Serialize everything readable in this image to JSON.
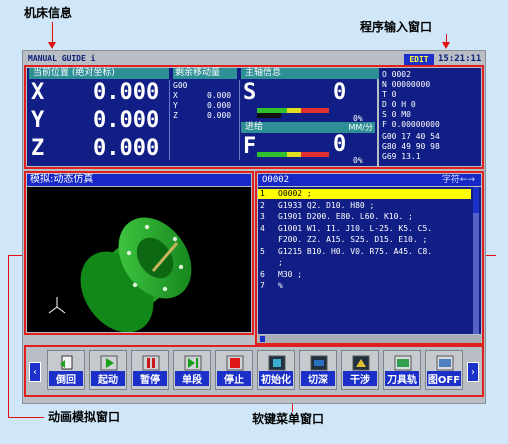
{
  "annotations": {
    "machine_info": "机床信息",
    "program_input": "程序输入窗口",
    "animation_window": "动画模拟窗口",
    "softkey_window": "软键菜单窗口"
  },
  "status_bar": {
    "title": "MANUAL GUIDE i",
    "mode": "EDIT",
    "time": "15:21:11"
  },
  "position": {
    "header": "当前位置 (绝对坐标)",
    "axes": [
      {
        "axis": "X",
        "value": "0.000"
      },
      {
        "axis": "Y",
        "value": "0.000"
      },
      {
        "axis": "Z",
        "value": "0.000"
      }
    ]
  },
  "remaining": {
    "header": "剩余移动量",
    "code": "G00",
    "rows": [
      {
        "axis": "X",
        "value": "0.000"
      },
      {
        "axis": "Y",
        "value": "0.000"
      },
      {
        "axis": "Z",
        "value": "0.000"
      }
    ]
  },
  "spindle": {
    "header": "主轴信息",
    "letter": "S",
    "value": "0",
    "load_pct": "0%",
    "load_fraction": 0
  },
  "feed": {
    "header": "进给",
    "unit": "MM/分",
    "letter": "F",
    "value": "0",
    "load_pct": "0%",
    "load_fraction": 0
  },
  "modal": {
    "lines": [
      "O  0002",
      "N  00000000",
      "T  0",
      "D  0      H  0",
      "S       0  M0",
      "F  0.00000000",
      "G00   17   40   54",
      "G80   49   90   98",
      "G69   13.1"
    ]
  },
  "simulation": {
    "title": "模拟:动态仿真"
  },
  "program": {
    "name": "O0002",
    "mode_label": "字符←→",
    "lines": [
      {
        "num": "1",
        "text": "O0002 ;"
      },
      {
        "num": "2",
        "text": "G1933 Q2. D10. H80 ;"
      },
      {
        "num": "3",
        "text": "G1901 D200. E80. L60. K10. ;"
      },
      {
        "num": "4",
        "text": "G1001 W1. I1. J10. L-25. K5. C5."
      },
      {
        "num": "",
        "text": "F200. Z2. A15. S25. D15. E10. ;"
      },
      {
        "num": "5",
        "text": "G1215 B10. H0. V0. R75. A45. C8."
      },
      {
        "num": "",
        "text": ";"
      },
      {
        "num": "6",
        "text": "M30 ;"
      },
      {
        "num": "7",
        "text": "%"
      }
    ]
  },
  "softkeys": [
    {
      "label": "倒回",
      "icon": "rewind-icon"
    },
    {
      "label": "起动",
      "icon": "play-icon"
    },
    {
      "label": "暂停",
      "icon": "pause-icon"
    },
    {
      "label": "单段",
      "icon": "single-step-icon"
    },
    {
      "label": "停止",
      "icon": "stop-icon"
    },
    {
      "label": "初始化",
      "icon": "initialize-icon"
    },
    {
      "label": "切深",
      "icon": "cut-depth-icon"
    },
    {
      "label": "干涉",
      "icon": "interference-icon"
    },
    {
      "label": "刀具轨",
      "icon": "tool-path-icon"
    },
    {
      "label": "图OFF",
      "icon": "graphic-off-icon"
    }
  ],
  "colors": {
    "background": "#cfe7f8",
    "panel_blue": "#101e86",
    "header_teal": "#2e8f95",
    "highlight_yellow": "#ffff00",
    "annotation_red": "#e02020",
    "part_green": "#22b022"
  }
}
